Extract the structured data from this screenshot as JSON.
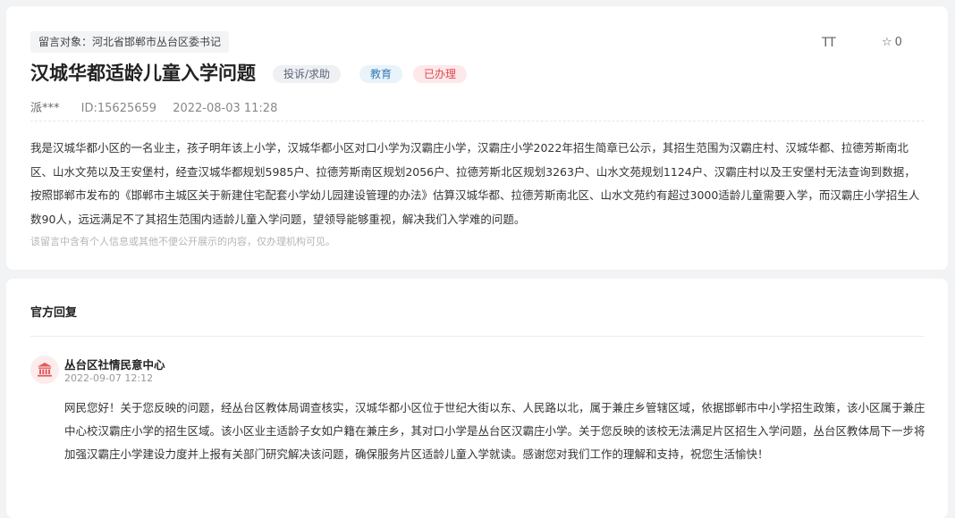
{
  "message": {
    "target": "留言对象：河北省邯郸市丛台区委书记",
    "font_toggle_label": "TT",
    "favorite_count": "0",
    "title": "汉城华都适龄儿童入学问题",
    "tags": {
      "type": "投诉/求助",
      "category": "教育",
      "status": "已办理"
    },
    "author": "派***",
    "id": "ID:15625659",
    "datetime": "2022-08-03 11:28",
    "content": "我是汉城华都小区的一名业主，孩子明年该上小学，汉城华都小区对口小学为汉霸庄小学，汉霸庄小学2022年招生简章已公示，其招生范围为汉霸庄村、汉城华都、拉德芳斯南北区、山水文苑以及王安堡村，经查汉城华都规划5985户、拉德芳斯南区规划2056户、拉德芳斯北区规划3263户、山水文苑规划1124户、汉霸庄村以及王安堡村无法查询到数据，按照邯郸市发布的《邯郸市主城区关于新建住宅配套小学幼儿园建设管理的办法》估算汉城华都、拉德芳斯南北区、山水文苑约有超过3000适龄儿童需要入学，而汉霸庄小学招生人数90人，远远满足不了其招生范围内适龄儿童入学问题，望领导能够重视，解决我们入学难的问题。",
    "privacy_notice": "该留言中含有个人信息或其他不便公开展示的内容，仅办理机构可见。"
  },
  "reply": {
    "heading": "官方回复",
    "org_name": "丛台区社情民意中心",
    "datetime": "2022-09-07 12:12",
    "content": "网民您好！关于您反映的问题，经丛台区教体局调查核实，汉城华都小区位于世纪大街以东、人民路以北，属于兼庄乡管辖区域，依据邯郸市中小学招生政策，该小区属于兼庄中心校汉霸庄小学的招生区域。该小区业主适龄子女如户籍在兼庄乡，其对口小学是丛台区汉霸庄小学。关于您反映的该校无法满足片区招生入学问题，丛台区教体局下一步将加强汉霸庄小学建设力度并上报有关部门研究解决该问题，确保服务片区适龄儿童入学就读。感谢您对我们工作的理解和支持，祝您生活愉快！"
  },
  "icons": {
    "font_size": "font-size-icon",
    "favorite": "star-outline-icon",
    "org": "government-building-icon"
  },
  "colors": {
    "status_red": "#e0484f",
    "category_blue": "#3a78b0",
    "org_icon_red": "#e35b5b"
  }
}
